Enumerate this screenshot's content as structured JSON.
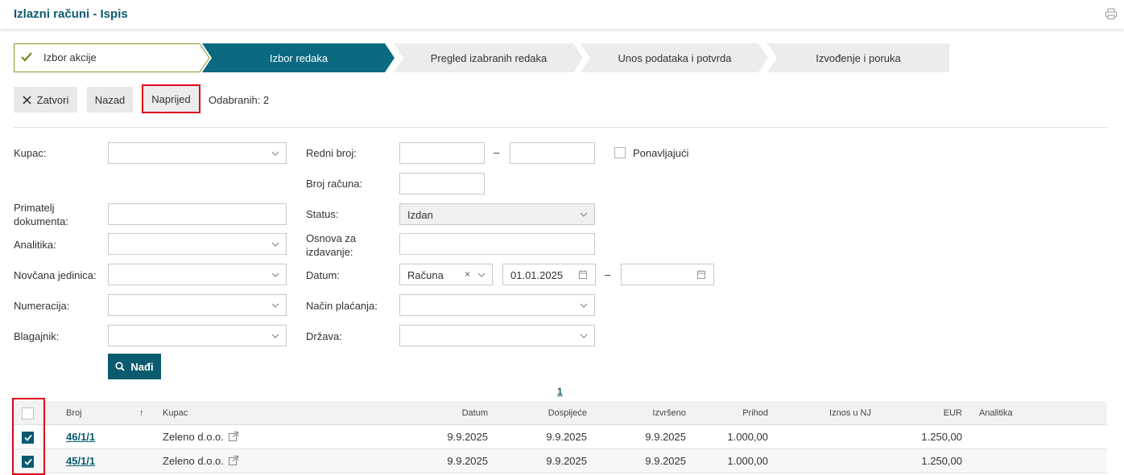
{
  "header": {
    "title": "Izlazni računi - Ispis",
    "print_icon": "printer-icon"
  },
  "steps": [
    {
      "label": "Izbor akcije",
      "state": "done"
    },
    {
      "label": "Izbor redaka",
      "state": "active"
    },
    {
      "label": "Pregled izabranih redaka",
      "state": "todo"
    },
    {
      "label": "Unos podataka i potvrda",
      "state": "todo"
    },
    {
      "label": "Izvođenje i poruka",
      "state": "todo"
    }
  ],
  "toolbar": {
    "close_label": "Zatvori",
    "back_label": "Nazad",
    "next_label": "Naprijed",
    "selected_text": "Odabranih: 2"
  },
  "filters": {
    "kupac_label": "Kupac:",
    "primatelj_label_1": "Primatelj",
    "primatelj_label_2": "dokumenta:",
    "analitika_label": "Analitika:",
    "novcana_label": "Novčana jedinica:",
    "numeracija_label": "Numeracija:",
    "blagajnik_label": "Blagajnik:",
    "redni_broj_label": "Redni broj:",
    "broj_racuna_label": "Broj računa:",
    "status_label": "Status:",
    "status_value": "Izdan",
    "osnova_label_1": "Osnova za",
    "osnova_label_2": "izdavanje:",
    "datum_label": "Datum:",
    "datum_type": "Računa",
    "datum_from": "01.01.2025",
    "nacin_label": "Način plaćanja:",
    "drzava_label": "Država:",
    "ponavljajuci_label": "Ponavljajući",
    "dash": "–",
    "clear_glyph": "×"
  },
  "find_label": "Nađi",
  "pager": {
    "current_page": "1"
  },
  "table": {
    "headers": {
      "broj": "Broj",
      "sort_glyph": "↑",
      "kupac": "Kupac",
      "datum": "Datum",
      "dospijece": "Dospijeće",
      "izvrseno": "Izvršeno",
      "prihod": "Prihod",
      "iznos_nj": "Iznos u NJ",
      "eur": "EUR",
      "analitika": "Analitika"
    },
    "rows": [
      {
        "broj": "46/1/1",
        "kupac": "Zeleno d.o.o.",
        "datum": "9.9.2025",
        "dospijece": "9.9.2025",
        "izvrseno": "9.9.2025",
        "prihod": "1.000,00",
        "iznos_nj": "",
        "eur": "1.250,00",
        "analitika": "",
        "checked": true
      },
      {
        "broj": "45/1/1",
        "kupac": "Zeleno d.o.o.",
        "datum": "9.9.2025",
        "dospijece": "9.9.2025",
        "izvrseno": "9.9.2025",
        "prihod": "1.000,00",
        "iznos_nj": "",
        "eur": "1.250,00",
        "analitika": "",
        "checked": true
      }
    ]
  },
  "colors": {
    "brand": "#0b5a6e",
    "highlight": "#e0001b",
    "step_inactive": "#ececec",
    "check_green": "#6f8a1f"
  }
}
